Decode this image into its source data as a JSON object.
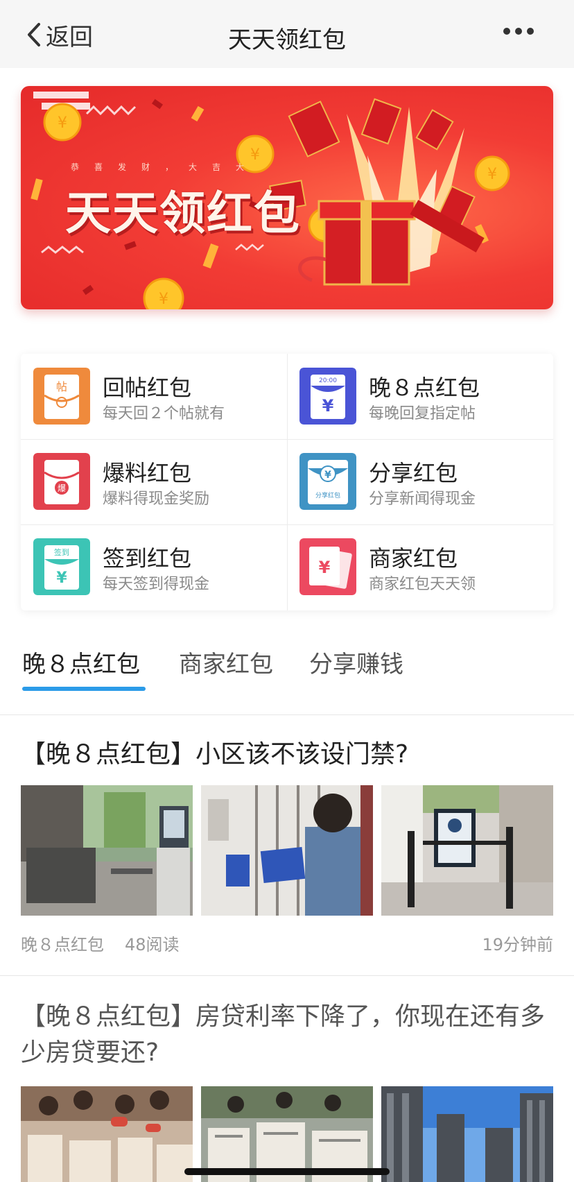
{
  "header": {
    "back_label": "返回",
    "title": "天天领红包"
  },
  "banner": {
    "subtitle": "恭喜发财，大吉大",
    "title": "天天领红包"
  },
  "grid": [
    {
      "title": "回帖红包",
      "subtitle": "每天回２个帖就有",
      "icon": "reply-envelope-icon",
      "color": "#ef8a3c",
      "glyph": "帖"
    },
    {
      "title": "晚８点红包",
      "subtitle": "每晚回复指定帖",
      "icon": "clock-envelope-icon",
      "color": "#4a54d6",
      "glyph": "20:00"
    },
    {
      "title": "爆料红包",
      "subtitle": "爆料得现金奖励",
      "icon": "scoop-envelope-icon",
      "color": "#e2414d",
      "glyph": "爆"
    },
    {
      "title": "分享红包",
      "subtitle": "分享新闻得现金",
      "icon": "share-envelope-icon",
      "color": "#3f93c4",
      "glyph": "分享红包"
    },
    {
      "title": "签到红包",
      "subtitle": "每天签到得现金",
      "icon": "checkin-envelope-icon",
      "color": "#3cc4b5",
      "glyph": "签到"
    },
    {
      "title": "商家红包",
      "subtitle": "商家红包天天领",
      "icon": "merchant-envelope-icon",
      "color": "#ec4960",
      "glyph": "¥"
    }
  ],
  "tabs": [
    {
      "label": "晚８点红包",
      "active": true
    },
    {
      "label": "商家红包",
      "active": false
    },
    {
      "label": "分享赚钱",
      "active": false
    }
  ],
  "articles": [
    {
      "title": "【晚８点红包】小区该不该设门禁?",
      "category": "晚８点红包",
      "reads": "48阅读",
      "time": "19分钟前"
    },
    {
      "title": "【晚８点红包】房贷利率下降了，你现在还有多少房贷要还?"
    }
  ],
  "colors": {
    "accent": "#2b9be8",
    "banner_red": "#f23c35"
  }
}
